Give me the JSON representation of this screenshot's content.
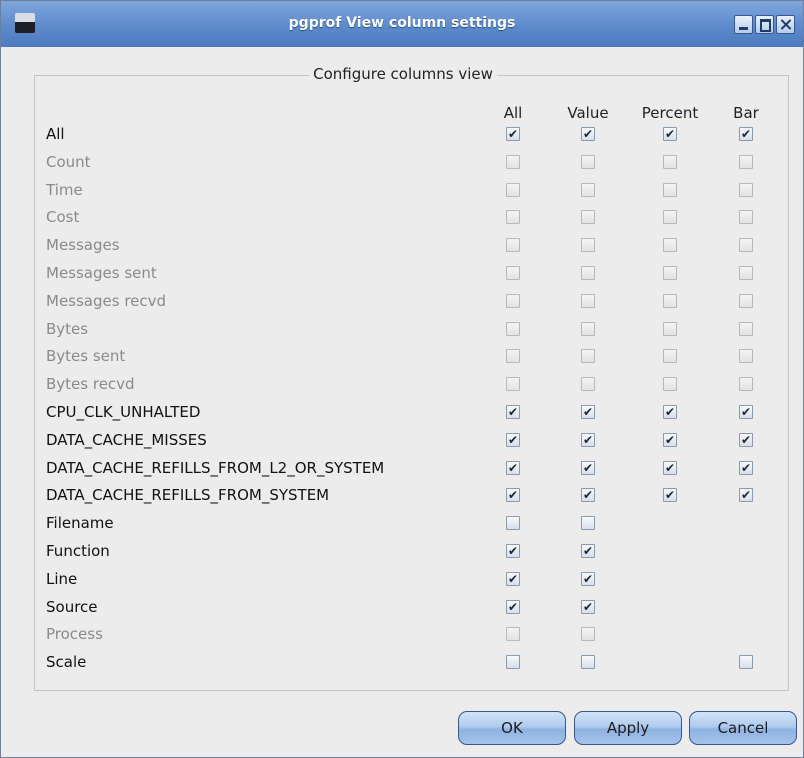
{
  "window": {
    "title": "pgprof View column settings"
  },
  "group": {
    "title": "Configure columns view"
  },
  "columns": [
    "All",
    "Value",
    "Percent",
    "Bar"
  ],
  "rows": [
    {
      "label": "All",
      "enabled": true,
      "checks": [
        true,
        true,
        true,
        true
      ]
    },
    {
      "label": "Count",
      "enabled": false,
      "checks": [
        false,
        false,
        false,
        false
      ]
    },
    {
      "label": "Time",
      "enabled": false,
      "checks": [
        false,
        false,
        false,
        false
      ]
    },
    {
      "label": "Cost",
      "enabled": false,
      "checks": [
        false,
        false,
        false,
        false
      ]
    },
    {
      "label": "Messages",
      "enabled": false,
      "checks": [
        false,
        false,
        false,
        false
      ]
    },
    {
      "label": "Messages sent",
      "enabled": false,
      "checks": [
        false,
        false,
        false,
        false
      ]
    },
    {
      "label": "Messages recvd",
      "enabled": false,
      "checks": [
        false,
        false,
        false,
        false
      ]
    },
    {
      "label": "Bytes",
      "enabled": false,
      "checks": [
        false,
        false,
        false,
        false
      ]
    },
    {
      "label": "Bytes sent",
      "enabled": false,
      "checks": [
        false,
        false,
        false,
        false
      ]
    },
    {
      "label": "Bytes recvd",
      "enabled": false,
      "checks": [
        false,
        false,
        false,
        false
      ]
    },
    {
      "label": "CPU_CLK_UNHALTED",
      "enabled": true,
      "checks": [
        true,
        true,
        true,
        true
      ]
    },
    {
      "label": "DATA_CACHE_MISSES",
      "enabled": true,
      "checks": [
        true,
        true,
        true,
        true
      ]
    },
    {
      "label": "DATA_CACHE_REFILLS_FROM_L2_OR_SYSTEM",
      "enabled": true,
      "checks": [
        true,
        true,
        true,
        true
      ]
    },
    {
      "label": "DATA_CACHE_REFILLS_FROM_SYSTEM",
      "enabled": true,
      "checks": [
        true,
        true,
        true,
        true
      ]
    },
    {
      "label": "Filename",
      "enabled": true,
      "checks": [
        false,
        false,
        null,
        null
      ]
    },
    {
      "label": "Function",
      "enabled": true,
      "checks": [
        true,
        true,
        null,
        null
      ]
    },
    {
      "label": "Line",
      "enabled": true,
      "checks": [
        true,
        true,
        null,
        null
      ]
    },
    {
      "label": "Source",
      "enabled": true,
      "checks": [
        true,
        true,
        null,
        null
      ]
    },
    {
      "label": "Process",
      "enabled": false,
      "checks": [
        false,
        false,
        null,
        null
      ]
    },
    {
      "label": "Scale",
      "enabled": true,
      "checks": [
        false,
        false,
        null,
        false
      ]
    }
  ],
  "buttons": {
    "ok": "OK",
    "apply": "Apply",
    "cancel": "Cancel"
  }
}
